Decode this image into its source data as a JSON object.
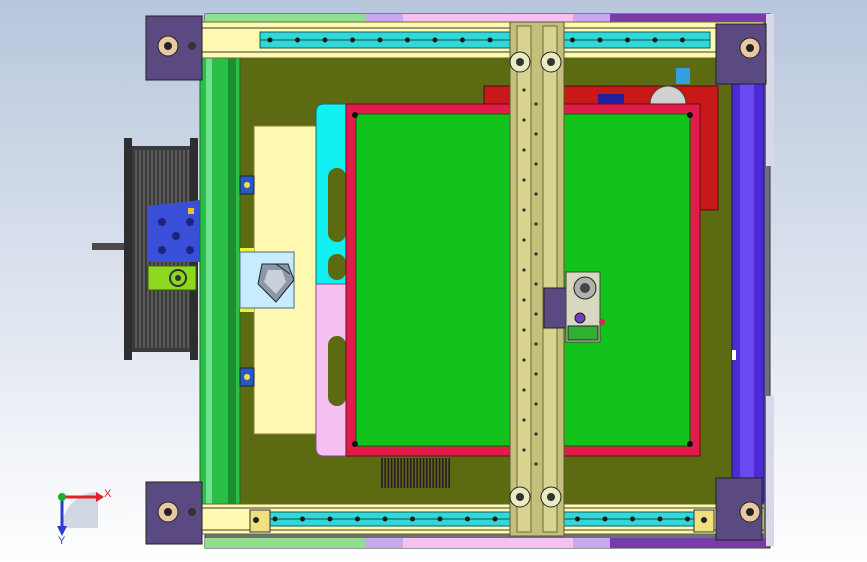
{
  "viewport": {
    "background_top": "#b8c6dc",
    "background_bottom": "#ffffff"
  },
  "triad": {
    "x_label": "X",
    "y_label": "Y",
    "x_color": "#e0202a",
    "y_color": "#2a3ccf",
    "z_color": "#18b030"
  },
  "colors": {
    "frame_purple": "#5b4a82",
    "frame_blue": "#4a2bd6",
    "base_olive": "#5c6a12",
    "bed_green": "#10c21a",
    "bed_red": "#e21c4a",
    "gantry": "#c4c07a",
    "rail_cyan": "#32d8d8",
    "rail_yellow": "#fff8b0",
    "pcb_red": "#c81818",
    "side_green": "#2bbf4a",
    "cyan_block": "#10f0f0",
    "pink_block": "#f6c0f0",
    "spool": "#303030"
  }
}
